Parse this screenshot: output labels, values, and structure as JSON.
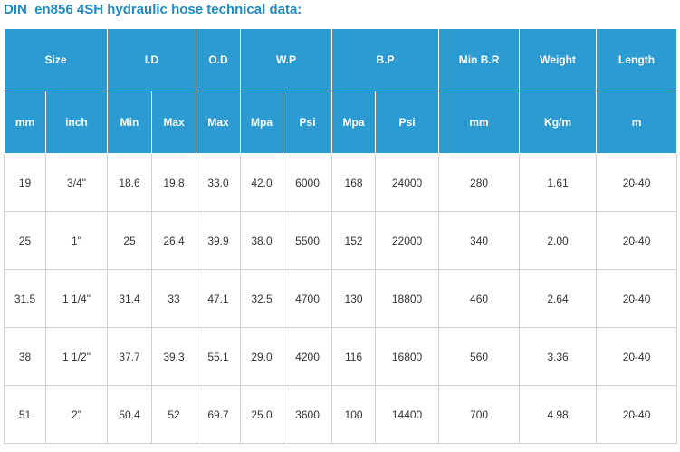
{
  "title": "DIN  en856 4SH hydraulic hose technical data:",
  "header_groups": [
    "Size",
    "I.D",
    "O.D",
    "W.P",
    "B.P",
    "Min B.R",
    "Weight",
    "Length"
  ],
  "subheaders": [
    "mm",
    "inch",
    "Min",
    "Max",
    "Max",
    "Mpa",
    "Psi",
    "Mpa",
    "Psi",
    "mm",
    "Kg/m",
    "m"
  ],
  "rows": [
    [
      "19",
      "3/4\"",
      "18.6",
      "19.8",
      "33.0",
      "42.0",
      "6000",
      "168",
      "24000",
      "280",
      "1.61",
      "20-40"
    ],
    [
      "25",
      "1\"",
      "25",
      "26.4",
      "39.9",
      "38.0",
      "5500",
      "152",
      "22000",
      "340",
      "2.00",
      "20-40"
    ],
    [
      "31.5",
      "1 1/4\"",
      "31.4",
      "33",
      "47.1",
      "32.5",
      "4700",
      "130",
      "18800",
      "460",
      "2.64",
      "20-40"
    ],
    [
      "38",
      "1 1/2\"",
      "37.7",
      "39.3",
      "55.1",
      "29.0",
      "4200",
      "116",
      "16800",
      "560",
      "3.36",
      "20-40"
    ],
    [
      "51",
      "2\"",
      "50.4",
      "52",
      "69.7",
      "25.0",
      "3600",
      "100",
      "14400",
      "700",
      "4.98",
      "20-40"
    ]
  ],
  "colors": {
    "header_bg": "#2b9bd2",
    "title": "#1e8bc3",
    "border": "#cfcfcf"
  }
}
